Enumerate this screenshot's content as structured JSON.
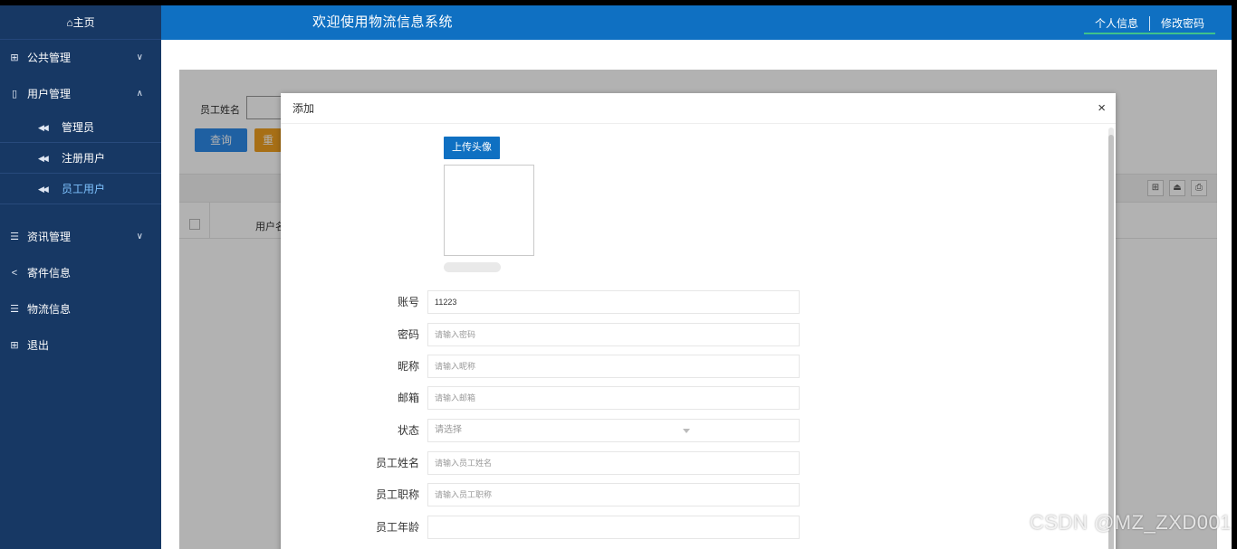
{
  "sidebar": {
    "home": "⌂主页",
    "items": [
      {
        "label": "公共管理",
        "icon": "grid-icon",
        "expandable": true
      },
      {
        "label": "用户管理",
        "icon": "book-icon",
        "expandable": true,
        "expanded": true
      },
      {
        "label": "资讯管理",
        "icon": "list-icon",
        "expandable": true
      },
      {
        "label": "寄件信息",
        "icon": "share-icon",
        "expandable": false
      },
      {
        "label": "物流信息",
        "icon": "list-icon",
        "expandable": false
      },
      {
        "label": "退出",
        "icon": "grid-icon",
        "expandable": false
      }
    ],
    "sub_items": [
      {
        "label": "管理员"
      },
      {
        "label": "注册用户"
      },
      {
        "label": "员工用户",
        "active": true
      }
    ]
  },
  "topbar": {
    "title": "欢迎使用物流信息系统",
    "profile_link": "个人信息",
    "password_link": "修改密码"
  },
  "search": {
    "label": "员工姓名",
    "query_button": "查询",
    "reset_button": "重"
  },
  "table": {
    "column_username": "用户名"
  },
  "modal": {
    "title": "添加",
    "close": "×",
    "upload_button": "上传头像",
    "fields": [
      {
        "label": "账号",
        "value": "11223",
        "placeholder": ""
      },
      {
        "label": "密码",
        "value": "",
        "placeholder": "请输入密码"
      },
      {
        "label": "昵称",
        "value": "",
        "placeholder": "请输入昵称"
      },
      {
        "label": "邮箱",
        "value": "",
        "placeholder": "请输入邮箱"
      },
      {
        "label": "状态",
        "value": "",
        "placeholder": "请选择"
      },
      {
        "label": "员工姓名",
        "value": "",
        "placeholder": "请输入员工姓名"
      },
      {
        "label": "员工职称",
        "value": "",
        "placeholder": "请输入员工职称"
      },
      {
        "label": "员工年龄",
        "value": "",
        "placeholder": ""
      }
    ]
  },
  "watermark": "CSDN @MZ_ZXD001",
  "colors": {
    "sidebar_bg": "#173864",
    "topbar_bg": "#0f70c2",
    "primary": "#0f70c2",
    "query_btn": "#2d8ae8",
    "reset_btn": "#f0a020",
    "active_link": "#7fc3ff"
  }
}
